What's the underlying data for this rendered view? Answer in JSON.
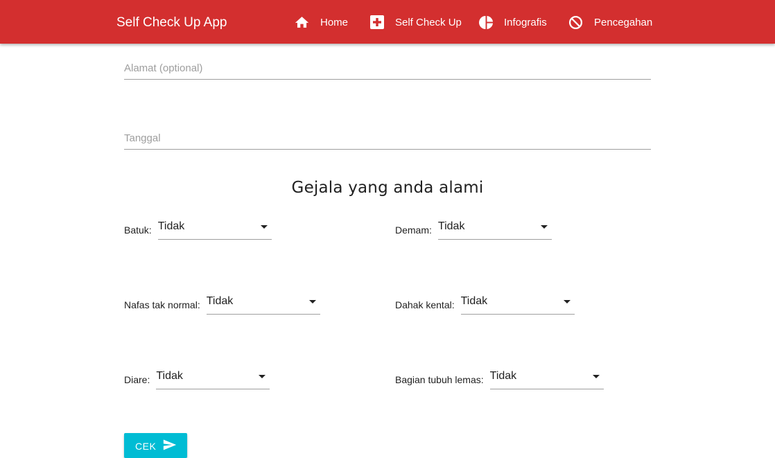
{
  "appbar": {
    "brand": "Self Check Up App",
    "color": "#d32f2f",
    "nav": [
      {
        "icon": "home-icon",
        "label": "Home"
      },
      {
        "icon": "medical-cross-icon",
        "label": "Self Check Up"
      },
      {
        "icon": "pie-chart-icon",
        "label": "Infografis"
      },
      {
        "icon": "block-icon",
        "label": "Pencegahan"
      }
    ]
  },
  "form": {
    "alamat_placeholder": "Alamat (optional)",
    "tanggal_placeholder": "Tanggal",
    "section_title": "Gejala yang anda alami",
    "symptoms": [
      {
        "label": "Batuk:",
        "value": "Tidak"
      },
      {
        "label": "Demam:",
        "value": "Tidak"
      },
      {
        "label": "Nafas tak normal:",
        "value": "Tidak"
      },
      {
        "label": "Dahak kental:",
        "value": "Tidak"
      },
      {
        "label": "Diare:",
        "value": "Tidak"
      },
      {
        "label": "Bagian tubuh lemas:",
        "value": "Tidak"
      }
    ],
    "submit_label": "CEK",
    "submit_color": "#00bcd4"
  }
}
